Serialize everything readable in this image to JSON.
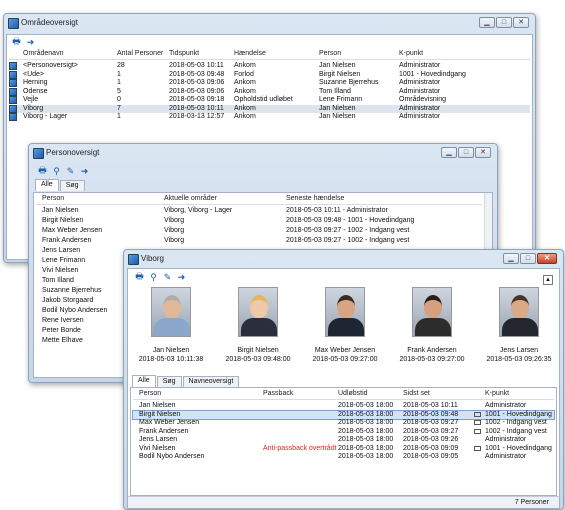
{
  "omraade": {
    "title": "Områdeoversigt",
    "columns": [
      "Områdenavn",
      "Antal Personer",
      "Tidspunkt",
      "Hændelse",
      "Person",
      "K-punkt"
    ],
    "rows": [
      [
        "<Personoversigt>",
        "28",
        "2018-05-03 10:11",
        "Ankom",
        "Jan Nielsen",
        "Administrator"
      ],
      [
        "<Ude>",
        "1",
        "2018-05-03 09:48",
        "Forlod",
        "Birgit Nielsen",
        "1001 - Hovedindgang"
      ],
      [
        "Herning",
        "1",
        "2018-05-03 09:06",
        "Ankom",
        "Suzanne Bjerrehus",
        "Administrator"
      ],
      [
        "Odense",
        "5",
        "2018-05-03 09:06",
        "Ankom",
        "Tom Illand",
        "Administrator"
      ],
      [
        "Vejle",
        "0",
        "2018-05-03 09:18",
        "Opholdstid udløbet",
        "Lene Frimann",
        "Områdevisning"
      ],
      [
        "Viborg",
        "7",
        "2018-05-03 10:11",
        "Ankom",
        "Jan Nielsen",
        "Administrator"
      ],
      [
        "Viborg - Lager",
        "1",
        "2018-03-13 12:57",
        "Ankom",
        "Jan Nielsen",
        "Administrator"
      ]
    ]
  },
  "person": {
    "title": "Personoversigt",
    "tabs": [
      "Alle",
      "Søg"
    ],
    "columns": [
      "Person",
      "Aktuelle områder",
      "Seneste hændelse"
    ],
    "rows": [
      [
        "Jan Nielsen",
        "Viborg, Viborg - Lager",
        "2018-05-03 10:11 - Administrator"
      ],
      [
        "Birgit Nielsen",
        "Viborg",
        "2018-05-03 09:48 - 1001 - Hovedindgang"
      ],
      [
        "Max Weber Jensen",
        "Viborg",
        "2018-05-03 09:27 - 1002 - Indgang vest"
      ],
      [
        "Frank Andersen",
        "Viborg",
        "2018-05-03 09:27 - 1002 - Indgang vest"
      ],
      [
        "Jens Larsen",
        "",
        ""
      ],
      [
        "Lene Frimann",
        "",
        ""
      ],
      [
        "Vivi Nielsen",
        "",
        ""
      ],
      [
        "Tom Illand",
        "",
        ""
      ],
      [
        "Suzanne Bjerrehus",
        "",
        ""
      ],
      [
        "Jakob Storgaard",
        "",
        ""
      ],
      [
        "Bodil Nybo Andersen",
        "",
        ""
      ],
      [
        "Rene Iversen",
        "",
        ""
      ],
      [
        "Peter Bonde",
        "",
        ""
      ],
      [
        "Mette Elhave",
        "",
        ""
      ]
    ]
  },
  "viborg": {
    "title": "Viborg",
    "cards": [
      {
        "name": "Jan Nielsen",
        "time": "2018-05-03 10:11:38",
        "skin": "#e2b899",
        "hair": "#b0aca8",
        "shirt": "#8ba7c9"
      },
      {
        "name": "Birgit Nielsen",
        "time": "2018-05-03 09:48:00",
        "skin": "#efc9a7",
        "hair": "#e0b860",
        "shirt": "#2b2f3c"
      },
      {
        "name": "Max Weber Jensen",
        "time": "2018-05-03 09:27:00",
        "skin": "#d7a583",
        "hair": "#3a2b24",
        "shirt": "#1e2533"
      },
      {
        "name": "Frank Andersen",
        "time": "2018-05-03 09:27:00",
        "skin": "#d5a07e",
        "hair": "#2a1e18",
        "shirt": "#2c2c2c"
      },
      {
        "name": "Jens Larsen",
        "time": "2018-05-03 09:26:35",
        "skin": "#d9aa88",
        "hair": "#4a3426",
        "shirt": "#23262e"
      }
    ],
    "tabs": [
      "Alle",
      "Søg",
      "Navneoversigt"
    ],
    "columns": [
      "Person",
      "Passback",
      "Udløbstid",
      "Sidst set",
      "K-punkt"
    ],
    "rows": [
      [
        "Jan Nielsen",
        "",
        "2018-05-03 18:00",
        "2018-05-03 10:11",
        "Administrator"
      ],
      [
        "Birgit Nielsen",
        "",
        "2018-05-03 18:00",
        "2018-05-03 09:48",
        "1001 - Hovedindgang"
      ],
      [
        "Max Weber Jensen",
        "",
        "2018-05-03 18:00",
        "2018-05-03 09:27",
        "1002 - Indgang vest"
      ],
      [
        "Frank Andersen",
        "",
        "2018-05-03 18:00",
        "2018-05-03 09:27",
        "1002 - Indgang vest"
      ],
      [
        "Jens Larsen",
        "",
        "2018-05-03 18:00",
        "2018-05-03 09:26",
        "Administrator"
      ],
      [
        "Vivi Nielsen",
        "Anti-passback overtrådt",
        "2018-05-03 18:00",
        "2018-05-03 09:09",
        "1001 - Hovedindgang"
      ],
      [
        "Bodil Nybo Andersen",
        "",
        "2018-05-03 18:00",
        "2018-05-03 09:05",
        "Administrator"
      ]
    ],
    "status": "7 Personer"
  }
}
